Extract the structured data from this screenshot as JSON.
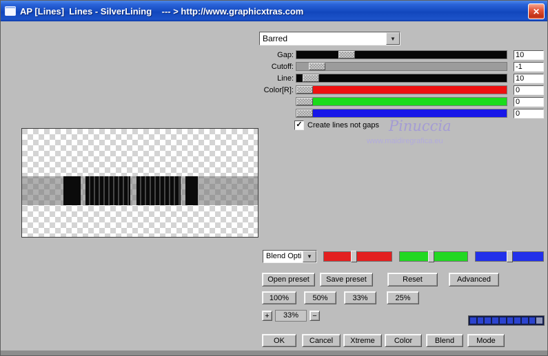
{
  "window": {
    "title": "AP [Lines]  Lines - SilverLining    --- > http://www.graphicxtras.com"
  },
  "icons": {
    "close": "✕",
    "dropdown_arrow": "▼",
    "check": "✓"
  },
  "pattern_dropdown": {
    "value": "Barred"
  },
  "sliders": [
    {
      "label": "Gap:",
      "value": "10",
      "track_color": "#060606",
      "thumb_pct": 20
    },
    {
      "label": "Cutoff:",
      "value": "-1",
      "track_color": "#9c9c9c",
      "thumb_pct": 6
    },
    {
      "label": "Line:",
      "value": "10",
      "track_color": "#060606",
      "thumb_pct": 3
    },
    {
      "label": "Color[R]:",
      "value": "0",
      "track_color": "#ee1010",
      "thumb_pct": 0
    },
    {
      "label": "",
      "value": "0",
      "track_color": "#1bdb1b",
      "thumb_pct": 0
    },
    {
      "label": "",
      "value": "0",
      "track_color": "#1717e8",
      "thumb_pct": 0
    }
  ],
  "checkbox": {
    "label": "Create lines not gaps",
    "checked": true
  },
  "watermark": {
    "line1": "Pinuccia",
    "line2": "www.maidiregrafica.eu"
  },
  "blend_dropdown": {
    "value": "Blend Opti"
  },
  "rgb_sliders": [
    {
      "name": "red",
      "color": "#e32020",
      "thumb_pct": 44
    },
    {
      "name": "green",
      "color": "#22d822",
      "thumb_pct": 46
    },
    {
      "name": "blue",
      "color": "#2230ea",
      "thumb_pct": 50
    }
  ],
  "preset_buttons": [
    {
      "label": "Open preset"
    },
    {
      "label": "Save preset"
    },
    {
      "label": "Reset"
    },
    {
      "label": "Advanced"
    }
  ],
  "percent_buttons": [
    {
      "label": "100%"
    },
    {
      "label": "50%"
    },
    {
      "label": "33%"
    },
    {
      "label": "25%"
    }
  ],
  "zoom_control": {
    "plus": "+",
    "value": "33%",
    "minus": "−"
  },
  "progress": {
    "filled": 9,
    "total": 10,
    "filled_color": "#2b43cf",
    "empty_color": "#8e95b8"
  },
  "bottom_buttons": [
    {
      "label": "OK"
    },
    {
      "label": "Cancel"
    },
    {
      "label": "Xtreme"
    },
    {
      "label": "Color"
    },
    {
      "label": "Blend"
    },
    {
      "label": "Mode"
    }
  ]
}
